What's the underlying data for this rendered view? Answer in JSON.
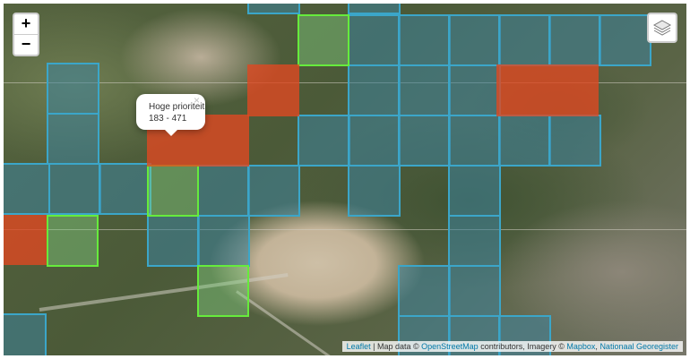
{
  "controls": {
    "zoom_in": "+",
    "zoom_out": "−",
    "layers_icon": "layers-icon"
  },
  "popup": {
    "title": "Hoge prioriteit",
    "range": "183 - 471",
    "close": "×"
  },
  "attribution": {
    "leaflet": "Leaflet",
    "sep": "| Map data ©",
    "osm": "OpenStreetMap",
    "contrib": "contributors, Imagery ©",
    "mapbox": "Mapbox",
    "comma": ",",
    "ngi": "Nationaal Georegister"
  },
  "colors": {
    "low_priority": "#3ba6c9",
    "medium_priority": "#66ec3c",
    "high_priority": "#de4822"
  }
}
